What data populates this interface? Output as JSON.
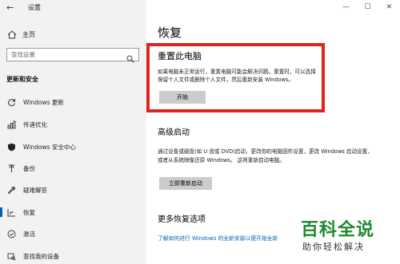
{
  "app": {
    "title": "设置",
    "back_icon": "back-arrow-icon"
  },
  "window_controls": {
    "minimize": "—",
    "maximize": "☐",
    "close": "✕"
  },
  "sidebar": {
    "home": {
      "label": "主页",
      "icon": "home-icon"
    },
    "search": {
      "placeholder": "查找设置",
      "icon": "search-icon"
    },
    "section_title": "更新和安全",
    "items": [
      {
        "label": "Windows 更新",
        "icon": "refresh-icon"
      },
      {
        "label": "传递优化",
        "icon": "delivery-optimization-icon"
      },
      {
        "label": "Windows 安全中心",
        "icon": "shield-icon"
      },
      {
        "label": "备份",
        "icon": "backup-arrow-icon"
      },
      {
        "label": "疑难解答",
        "icon": "wrench-icon"
      },
      {
        "label": "恢复",
        "icon": "recovery-icon",
        "active": true
      },
      {
        "label": "激活",
        "icon": "activation-check-icon"
      },
      {
        "label": "查找我的设备",
        "icon": "find-device-icon"
      }
    ]
  },
  "main": {
    "page_title": "恢复",
    "reset": {
      "title": "重置此电脑",
      "description": "如果电脑未正常运行，重置电脑可能会解决问题。重置时，可以选择保留个人文件或删除个人文件，然后重新安装 Windows。",
      "button": "开始"
    },
    "advanced": {
      "title": "高级启动",
      "description": "通过设备或磁盘(如 U 盘或 DVD)启动，更改你的电脑固件设置，更改 Windows 启动设置，或者从系统映像还原 Windows。 这将重新启动电脑。",
      "button": "立即重新启动"
    },
    "more": {
      "title": "更多恢复选项",
      "link": "了解如何进行 Windows 的全新安装以便开始全新"
    }
  },
  "watermark": {
    "main": "百科全说",
    "sub": "助你轻松解决"
  },
  "colors": {
    "highlight": "#e2231a",
    "accent": "#0063b1",
    "link": "#0066b4",
    "watermark": "#1f8a2e"
  }
}
